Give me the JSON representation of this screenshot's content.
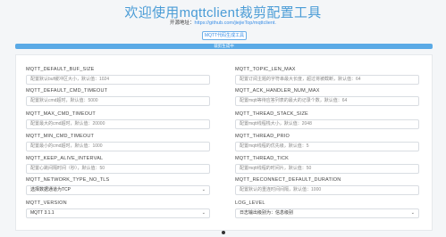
{
  "header": {
    "title": "欢迎使用mqttclient裁剪配置工具",
    "subtitle_prefix": "开源地址：",
    "subtitle_link": "https://github.com/jiejieTop/mqttclient.",
    "generate_button": "MQTT代码生成工具"
  },
  "progress": {
    "label": "裁剪生成中",
    "percent": 100
  },
  "form": {
    "left": [
      {
        "label": "MQTT_DEFAULT_BUF_SIZE",
        "placeholder": "配置默认buf缓冲区大小，默认值：1024",
        "type": "input"
      },
      {
        "label": "MQTT_DEFAULT_CMD_TIMEOUT",
        "placeholder": "配置默认cmd超时，默认值：5000",
        "type": "input"
      },
      {
        "label": "MQTT_MAX_CMD_TIMEOUT",
        "placeholder": "配置最大的cmd超时，默认值：20000",
        "type": "input"
      },
      {
        "label": "MQTT_MIN_CMD_TIMEOUT",
        "placeholder": "配置最小的cmd超时，默认值：1000",
        "type": "input"
      },
      {
        "label": "MQTT_KEEP_ALIVE_INTERVAL",
        "placeholder": "配置心跳间隔时间（秒），默认值：50",
        "type": "input"
      },
      {
        "label": "MQTT_NETWORK_TYPE_NO_TLS",
        "placeholder": "选择数据通道为TCP",
        "type": "select"
      },
      {
        "label": "MQTT_VERSION",
        "placeholder": "MQTT 3.1.1",
        "type": "select"
      }
    ],
    "right": [
      {
        "label": "MQTT_TOPIC_LEN_MAX",
        "placeholder": "配置订阅主题的字符串最大长度，超过将被截断，默认值：64",
        "type": "input"
      },
      {
        "label": "MQTT_ACK_HANDLER_NUM_MAX",
        "placeholder": "配置mqtt等待应答列表的最大的记录个数，默认值：64",
        "type": "input"
      },
      {
        "label": "MQTT_THREAD_STACK_SIZE",
        "placeholder": "配置mqtt线程栈大小，默认值：2048",
        "type": "input"
      },
      {
        "label": "MQTT_THREAD_PRIO",
        "placeholder": "配置mqtt线程的优先级，默认值：5",
        "type": "input"
      },
      {
        "label": "MQTT_THREAD_TICK",
        "placeholder": "配置mqtt线程的时间片，默认值：50",
        "type": "input"
      },
      {
        "label": "MQTT_RECONNECT_DEFAULT_DURATION",
        "placeholder": "配置默认的重连时间间隔，默认值：1000",
        "type": "input"
      },
      {
        "label": "LOG_LEVEL",
        "placeholder": "日志输出级别为：信息级别",
        "type": "select"
      }
    ]
  },
  "colors": {
    "accent": "#4a9cd6",
    "progress_fill": "#5aaae6"
  }
}
